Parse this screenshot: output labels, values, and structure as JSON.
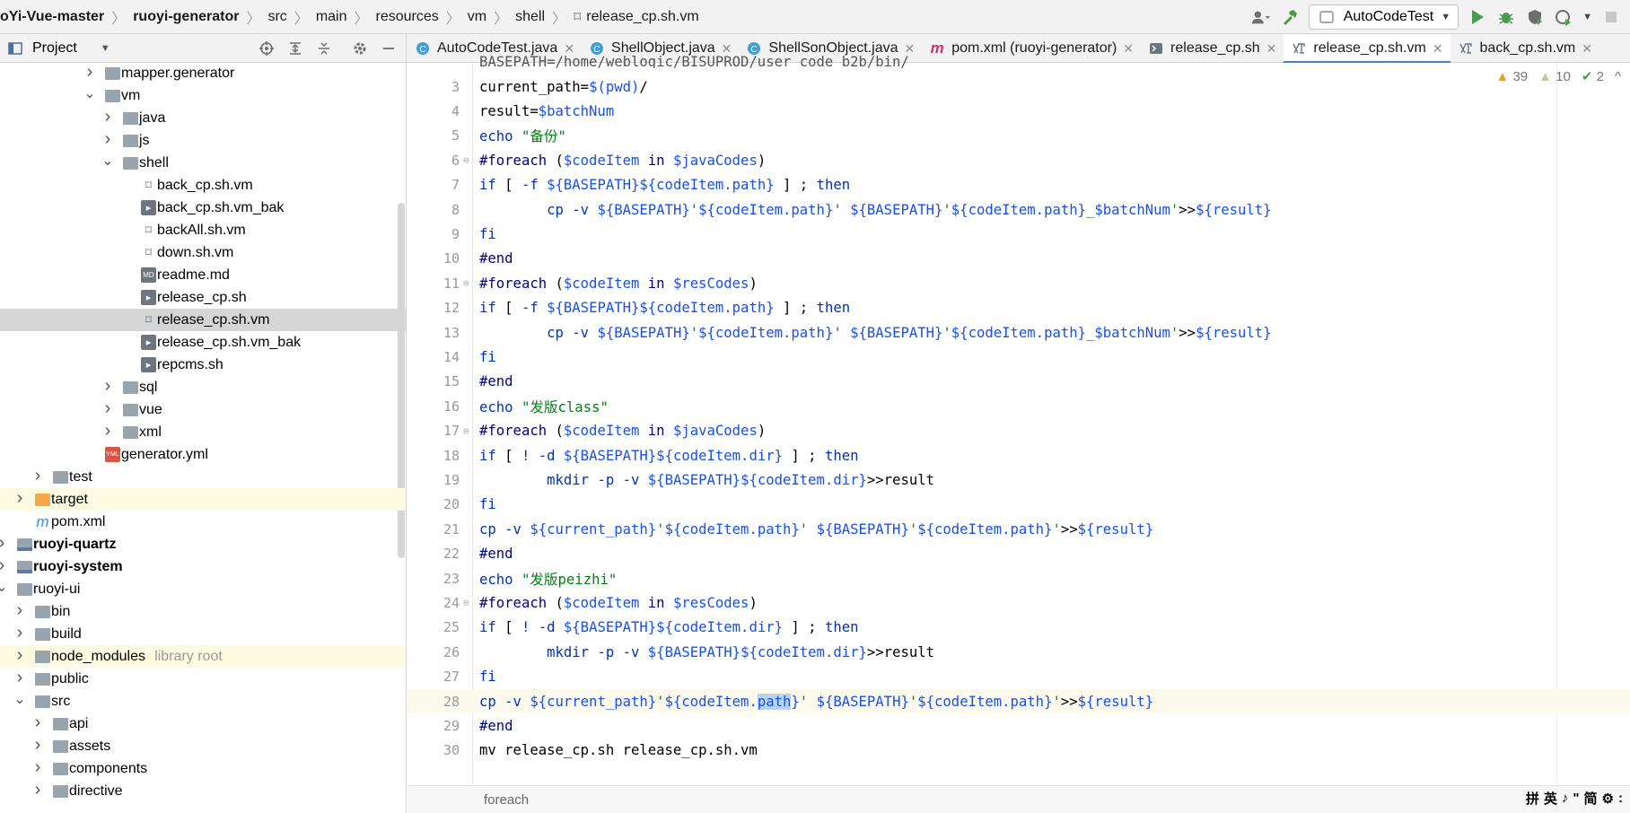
{
  "breadcrumbs": [
    "oYi-Vue-master",
    "ruoyi-generator",
    "src",
    "main",
    "resources",
    "vm",
    "shell",
    "release_cp.sh.vm"
  ],
  "run_config": "AutoCodeTest",
  "project_panel": {
    "title": "Project"
  },
  "tabs": [
    {
      "label": "AutoCodeTest.java",
      "icon": "java-class-icon"
    },
    {
      "label": "ShellObject.java",
      "icon": "java-class-icon"
    },
    {
      "label": "ShellSonObject.java",
      "icon": "java-class-icon"
    },
    {
      "label": "pom.xml (ruoyi-generator)",
      "icon": "maven-icon"
    },
    {
      "label": "release_cp.sh",
      "icon": "shell-script-icon"
    },
    {
      "label": "release_cp.sh.vm",
      "icon": "velocity-template-icon",
      "active": true
    },
    {
      "label": "back_cp.sh.vm",
      "icon": "velocity-template-icon"
    }
  ],
  "tree": [
    {
      "label": "mapper.generator",
      "type": "folder",
      "expand": "collapsed"
    },
    {
      "label": "vm",
      "type": "folder",
      "expand": "expanded"
    },
    {
      "label": "java",
      "type": "folder",
      "expand": "collapsed"
    },
    {
      "label": "js",
      "type": "folder",
      "expand": "collapsed"
    },
    {
      "label": "shell",
      "type": "folder",
      "expand": "expanded"
    },
    {
      "label": "back_cp.sh.vm",
      "type": "vm"
    },
    {
      "label": "back_cp.sh.vm_bak",
      "type": "sh"
    },
    {
      "label": "backAll.sh.vm",
      "type": "vm"
    },
    {
      "label": "down.sh.vm",
      "type": "vm"
    },
    {
      "label": "readme.md",
      "type": "md"
    },
    {
      "label": "release_cp.sh",
      "type": "sh"
    },
    {
      "label": "release_cp.sh.vm",
      "type": "vm",
      "selected": true
    },
    {
      "label": "release_cp.sh.vm_bak",
      "type": "sh"
    },
    {
      "label": "repcms.sh",
      "type": "sh"
    },
    {
      "label": "sql",
      "type": "folder",
      "expand": "collapsed"
    },
    {
      "label": "vue",
      "type": "folder",
      "expand": "collapsed"
    },
    {
      "label": "xml",
      "type": "folder",
      "expand": "collapsed"
    },
    {
      "label": "generator.yml",
      "type": "yml"
    },
    {
      "label": "test",
      "type": "folder",
      "expand": "collapsed"
    },
    {
      "label": "target",
      "type": "folder-orange",
      "expand": "collapsed",
      "excluded": true
    },
    {
      "label": "pom.xml",
      "type": "maven"
    },
    {
      "label": "ruoyi-quartz",
      "type": "module",
      "expand": "collapsed",
      "bold": true
    },
    {
      "label": "ruoyi-system",
      "type": "module",
      "expand": "collapsed",
      "bold": true
    },
    {
      "label": "ruoyi-ui",
      "type": "folder",
      "expand": "expanded"
    },
    {
      "label": "bin",
      "type": "folder",
      "expand": "collapsed"
    },
    {
      "label": "build",
      "type": "folder",
      "expand": "collapsed"
    },
    {
      "label": "node_modules",
      "type": "folder",
      "expand": "collapsed",
      "excluded": true,
      "suffix": "library root"
    },
    {
      "label": "public",
      "type": "folder",
      "expand": "collapsed"
    },
    {
      "label": "src",
      "type": "folder",
      "expand": "expanded"
    },
    {
      "label": "api",
      "type": "folder",
      "expand": "collapsed"
    },
    {
      "label": "assets",
      "type": "folder",
      "expand": "collapsed"
    },
    {
      "label": "components",
      "type": "folder",
      "expand": "collapsed"
    },
    {
      "label": "directive",
      "type": "folder",
      "expand": "collapsed"
    }
  ],
  "inspections": {
    "warnings": "39",
    "weak_warnings": "10",
    "ok": "2"
  },
  "code_lines": [
    {
      "n": "3",
      "tokens": [
        [
          "plain",
          "current_path="
        ],
        [
          "var",
          "$(pwd)"
        ],
        [
          "plain",
          "/"
        ]
      ]
    },
    {
      "n": "4",
      "tokens": [
        [
          "plain",
          "result="
        ],
        [
          "var",
          "$batchNum"
        ]
      ]
    },
    {
      "n": "5",
      "tokens": [
        [
          "kw",
          "echo "
        ],
        [
          "str",
          "\"备份\""
        ]
      ]
    },
    {
      "n": "6",
      "fold": true,
      "tokens": [
        [
          "dir",
          "#foreach "
        ],
        [
          "plain",
          "("
        ],
        [
          "var",
          "$codeItem "
        ],
        [
          "dir",
          "in "
        ],
        [
          "var",
          "$javaCodes"
        ],
        [
          "plain",
          ")"
        ]
      ]
    },
    {
      "n": "7",
      "tokens": [
        [
          "kw",
          "if "
        ],
        [
          "plain",
          "[ "
        ],
        [
          "kw",
          "-f "
        ],
        [
          "var",
          "${BASEPATH}${codeItem.path}"
        ],
        [
          "plain",
          " ] ; "
        ],
        [
          "kw",
          "then"
        ]
      ]
    },
    {
      "n": "8",
      "tokens": [
        [
          "plain",
          "        "
        ],
        [
          "kw",
          "cp "
        ],
        [
          "kw",
          "-v "
        ],
        [
          "var",
          "${BASEPATH}"
        ],
        [
          "str",
          "'"
        ],
        [
          "var",
          "${codeItem.path}"
        ],
        [
          "str",
          "' "
        ],
        [
          "var",
          "${BASEPATH}"
        ],
        [
          "str",
          "'"
        ],
        [
          "var",
          "${codeItem.path}"
        ],
        [
          "str",
          "_"
        ],
        [
          "var",
          "$batchNum"
        ],
        [
          "str",
          "'"
        ],
        [
          "plain",
          ">>"
        ],
        [
          "var",
          "${result}"
        ]
      ]
    },
    {
      "n": "9",
      "tokens": [
        [
          "kw",
          "fi"
        ]
      ]
    },
    {
      "n": "10",
      "tokens": [
        [
          "dir",
          "#end"
        ]
      ]
    },
    {
      "n": "11",
      "fold": true,
      "tokens": [
        [
          "dir",
          "#foreach "
        ],
        [
          "plain",
          "("
        ],
        [
          "var",
          "$codeItem "
        ],
        [
          "dir",
          "in "
        ],
        [
          "var",
          "$resCodes"
        ],
        [
          "plain",
          ")"
        ]
      ]
    },
    {
      "n": "12",
      "tokens": [
        [
          "kw",
          "if "
        ],
        [
          "plain",
          "[ "
        ],
        [
          "kw",
          "-f "
        ],
        [
          "var",
          "${BASEPATH}${codeItem.path}"
        ],
        [
          "plain",
          " ] ; "
        ],
        [
          "kw",
          "then"
        ]
      ]
    },
    {
      "n": "13",
      "tokens": [
        [
          "plain",
          "        "
        ],
        [
          "kw",
          "cp "
        ],
        [
          "kw",
          "-v "
        ],
        [
          "var",
          "${BASEPATH}"
        ],
        [
          "str",
          "'"
        ],
        [
          "var",
          "${codeItem.path}"
        ],
        [
          "str",
          "' "
        ],
        [
          "var",
          "${BASEPATH}"
        ],
        [
          "str",
          "'"
        ],
        [
          "var",
          "${codeItem.path}"
        ],
        [
          "str",
          "_"
        ],
        [
          "var",
          "$batchNum"
        ],
        [
          "str",
          "'"
        ],
        [
          "plain",
          ">>"
        ],
        [
          "var",
          "${result}"
        ]
      ]
    },
    {
      "n": "14",
      "tokens": [
        [
          "kw",
          "fi"
        ]
      ]
    },
    {
      "n": "15",
      "tokens": [
        [
          "dir",
          "#end"
        ]
      ]
    },
    {
      "n": "16",
      "tokens": [
        [
          "kw",
          "echo "
        ],
        [
          "str",
          "\"发版class\""
        ]
      ]
    },
    {
      "n": "17",
      "fold": true,
      "tokens": [
        [
          "dir",
          "#foreach "
        ],
        [
          "plain",
          "("
        ],
        [
          "var",
          "$codeItem "
        ],
        [
          "dir",
          "in "
        ],
        [
          "var",
          "$javaCodes"
        ],
        [
          "plain",
          ")"
        ]
      ]
    },
    {
      "n": "18",
      "tokens": [
        [
          "kw",
          "if "
        ],
        [
          "plain",
          "[ "
        ],
        [
          "kw",
          "! -d "
        ],
        [
          "var",
          "${BASEPATH}${codeItem.dir}"
        ],
        [
          "plain",
          " ] ; "
        ],
        [
          "kw",
          "then"
        ]
      ]
    },
    {
      "n": "19",
      "tokens": [
        [
          "plain",
          "        "
        ],
        [
          "kw",
          "mkdir "
        ],
        [
          "kw",
          "-p -v "
        ],
        [
          "var",
          "${BASEPATH}${codeItem.dir}"
        ],
        [
          "plain",
          ">>result"
        ]
      ]
    },
    {
      "n": "20",
      "tokens": [
        [
          "kw",
          "fi"
        ]
      ]
    },
    {
      "n": "21",
      "tokens": [
        [
          "kw",
          "cp "
        ],
        [
          "kw",
          "-v "
        ],
        [
          "var",
          "${current_path}"
        ],
        [
          "str",
          "'"
        ],
        [
          "var",
          "${codeItem.path}"
        ],
        [
          "str",
          "' "
        ],
        [
          "var",
          "${BASEPATH}"
        ],
        [
          "str",
          "'"
        ],
        [
          "var",
          "${codeItem.path}"
        ],
        [
          "str",
          "'"
        ],
        [
          "plain",
          ">>"
        ],
        [
          "var",
          "${result}"
        ]
      ]
    },
    {
      "n": "22",
      "tokens": [
        [
          "dir",
          "#end"
        ]
      ]
    },
    {
      "n": "23",
      "tokens": [
        [
          "kw",
          "echo "
        ],
        [
          "str",
          "\"发版peizhi\""
        ]
      ]
    },
    {
      "n": "24",
      "fold": true,
      "tokens": [
        [
          "dir",
          "#foreach "
        ],
        [
          "plain",
          "("
        ],
        [
          "var",
          "$codeItem "
        ],
        [
          "dir",
          "in "
        ],
        [
          "var",
          "$resCodes"
        ],
        [
          "plain",
          ")"
        ]
      ]
    },
    {
      "n": "25",
      "tokens": [
        [
          "kw",
          "if "
        ],
        [
          "plain",
          "[ "
        ],
        [
          "kw",
          "! -d "
        ],
        [
          "var",
          "${BASEPATH}${codeItem.dir}"
        ],
        [
          "plain",
          " ] ; "
        ],
        [
          "kw",
          "then"
        ]
      ]
    },
    {
      "n": "26",
      "tokens": [
        [
          "plain",
          "        "
        ],
        [
          "kw",
          "mkdir "
        ],
        [
          "kw",
          "-p -v "
        ],
        [
          "var",
          "${BASEPATH}${codeItem.dir}"
        ],
        [
          "plain",
          ">>result"
        ]
      ]
    },
    {
      "n": "27",
      "tokens": [
        [
          "kw",
          "fi"
        ]
      ]
    },
    {
      "n": "28",
      "current": true,
      "tokens": [
        [
          "kw",
          "cp "
        ],
        [
          "kw",
          "-v "
        ],
        [
          "var",
          "${current_path}"
        ],
        [
          "str",
          "'"
        ],
        [
          "var",
          "${codeItem."
        ],
        [
          "sel",
          "path"
        ],
        [
          "var",
          "}"
        ],
        [
          "str",
          "' "
        ],
        [
          "var",
          "${BASEPATH}"
        ],
        [
          "str",
          "'"
        ],
        [
          "var",
          "${codeItem.path}"
        ],
        [
          "str",
          "'"
        ],
        [
          "plain",
          ">>"
        ],
        [
          "var",
          "${result}"
        ]
      ]
    },
    {
      "n": "29",
      "tokens": [
        [
          "dir",
          "#end"
        ]
      ]
    },
    {
      "n": "30",
      "tokens": [
        [
          "plain",
          "mv release_cp.sh release_cp.sh.vm"
        ]
      ]
    }
  ],
  "partial_line": "BASEPATH=/home/weblogic/BISUPROD/user_code_b2b/bin/",
  "status_breadcrumb": "foreach",
  "ime_indicators": [
    "拼",
    "英",
    "♪",
    "\"",
    "简",
    "⚙",
    ":"
  ]
}
